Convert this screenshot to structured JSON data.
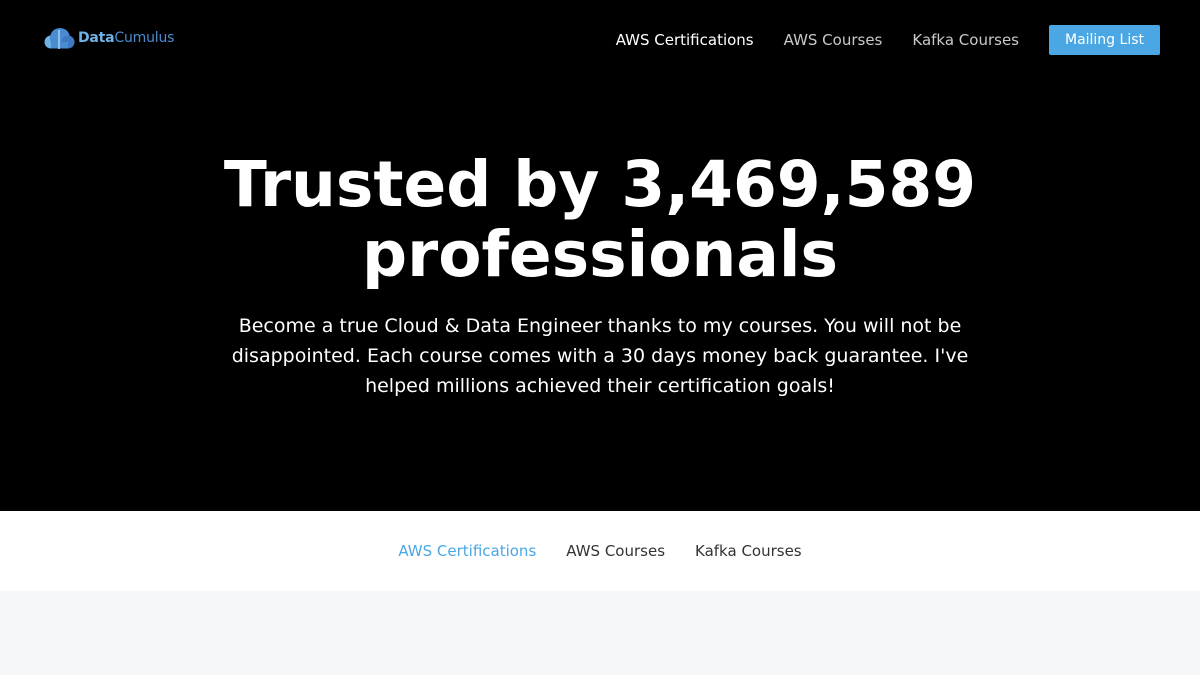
{
  "logo": {
    "part1": "Data",
    "part2": "Cumulus",
    "icon": "cloud-icon"
  },
  "nav": {
    "items": [
      "AWS Certifications",
      "AWS Courses",
      "Kafka Courses"
    ],
    "button_label": "Mailing List"
  },
  "hero": {
    "headline_line1": "Trusted by 3,469,589",
    "headline_line2": "professionals",
    "subheading": "Become a true Cloud & Data Engineer thanks to my courses. You will not be disappointed. Each course comes with a 30 days money back guarantee. I've helped millions achieved their certification goals!"
  },
  "tabs": {
    "items": [
      "AWS Certifications",
      "AWS Courses",
      "Kafka Courses"
    ]
  },
  "colors": {
    "hero_background": "#000000",
    "accent": "#4aa7e3",
    "page_background": "#f6f7f9"
  }
}
